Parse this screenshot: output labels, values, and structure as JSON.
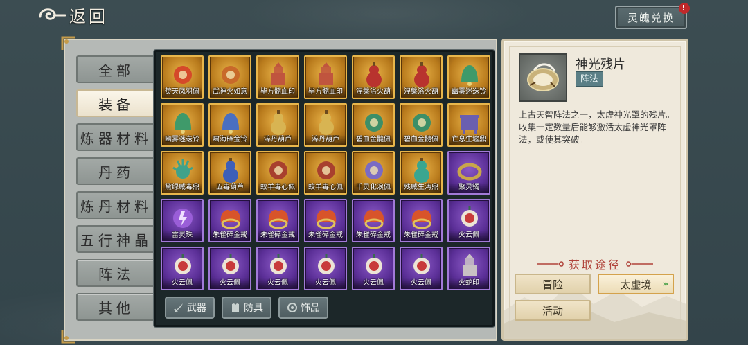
{
  "header": {
    "back_label": "返回",
    "exchange_label": "灵魄兑换",
    "exchange_badge": "!"
  },
  "categories": [
    {
      "label": "全部",
      "active": false
    },
    {
      "label": "装备",
      "active": true
    },
    {
      "label": "炼器材料",
      "active": false
    },
    {
      "label": "丹药",
      "active": false
    },
    {
      "label": "炼丹材料",
      "active": false
    },
    {
      "label": "五行神晶",
      "active": false
    },
    {
      "label": "阵法",
      "active": false
    },
    {
      "label": "其他",
      "active": false
    }
  ],
  "items": [
    {
      "name": "焚天凤羽佩",
      "rarity": "gold",
      "icon": "phoenix-feather-icon",
      "color": "#d5492a"
    },
    {
      "name": "武神火如意",
      "rarity": "gold",
      "icon": "ruyi-scepter-icon",
      "color": "#c8692a"
    },
    {
      "name": "毕方髓血印",
      "rarity": "gold",
      "icon": "seal-icon",
      "color": "#c0553e"
    },
    {
      "name": "毕方髓血印",
      "rarity": "gold",
      "icon": "seal-icon",
      "color": "#c0553e"
    },
    {
      "name": "涅槃浴火葫",
      "rarity": "gold",
      "icon": "gourd-icon",
      "color": "#b8332e"
    },
    {
      "name": "涅槃浴火葫",
      "rarity": "gold",
      "icon": "gourd-icon",
      "color": "#b8332e"
    },
    {
      "name": "幽雾迷迭铃",
      "rarity": "gold",
      "icon": "bell-icon",
      "color": "#3f9a6a"
    },
    {
      "name": "幽雾迷迭铃",
      "rarity": "gold",
      "icon": "bell-icon",
      "color": "#3f9a6a"
    },
    {
      "name": "啸海碎金铃",
      "rarity": "gold",
      "icon": "bell-icon",
      "color": "#4a6fc0"
    },
    {
      "name": "淬丹葫芦",
      "rarity": "gold",
      "icon": "gourd-icon",
      "color": "#d8b452"
    },
    {
      "name": "淬丹葫芦",
      "rarity": "gold",
      "icon": "gourd-icon",
      "color": "#d8b452"
    },
    {
      "name": "碧血金髓佩",
      "rarity": "gold",
      "icon": "jade-pendant-icon",
      "color": "#3c8f68"
    },
    {
      "name": "碧血金髓佩",
      "rarity": "gold",
      "icon": "jade-pendant-icon",
      "color": "#3c8f68"
    },
    {
      "name": "亡息生墟鼎",
      "rarity": "gold",
      "icon": "cauldron-icon",
      "color": "#6a5fb0"
    },
    {
      "name": "黛绿威毒鼎",
      "rarity": "gold",
      "icon": "spiky-orb-icon",
      "color": "#3fa28a"
    },
    {
      "name": "五毒葫芦",
      "rarity": "gold",
      "icon": "gourd-icon",
      "color": "#3d5fb8"
    },
    {
      "name": "蛟羊毒心佩",
      "rarity": "gold",
      "icon": "round-pendant-icon",
      "color": "#a8402e"
    },
    {
      "name": "蛟羊毒心佩",
      "rarity": "gold",
      "icon": "round-pendant-icon",
      "color": "#a8402e"
    },
    {
      "name": "千灵化浪佩",
      "rarity": "gold",
      "icon": "orb-pendant-icon",
      "color": "#7a6bc4"
    },
    {
      "name": "残威生涛鼎",
      "rarity": "gold",
      "icon": "gourd-icon",
      "color": "#3aa690"
    },
    {
      "name": "聚灵镯",
      "rarity": "purple",
      "icon": "bracelet-icon",
      "color": "#c9a64a"
    },
    {
      "name": "雷灵珠",
      "rarity": "purple",
      "icon": "thunder-orb-icon",
      "color": "#9a5ed8"
    },
    {
      "name": "朱雀碎金戒",
      "rarity": "purple",
      "icon": "phoenix-ring-icon",
      "color": "#d8542a"
    },
    {
      "name": "朱雀碎金戒",
      "rarity": "purple",
      "icon": "phoenix-ring-icon",
      "color": "#d8542a"
    },
    {
      "name": "朱雀碎金戒",
      "rarity": "purple",
      "icon": "phoenix-ring-icon",
      "color": "#d8542a"
    },
    {
      "name": "朱雀碎金戒",
      "rarity": "purple",
      "icon": "phoenix-ring-icon",
      "color": "#d8542a"
    },
    {
      "name": "朱雀碎金戒",
      "rarity": "purple",
      "icon": "phoenix-ring-icon",
      "color": "#d8542a"
    },
    {
      "name": "火云佩",
      "rarity": "purple",
      "icon": "knot-pendant-icon",
      "color": "#c83a3a"
    },
    {
      "name": "火云佩",
      "rarity": "purple",
      "icon": "knot-pendant-icon",
      "color": "#c83a3a"
    },
    {
      "name": "火云佩",
      "rarity": "purple",
      "icon": "knot-pendant-icon",
      "color": "#c83a3a"
    },
    {
      "name": "火云佩",
      "rarity": "purple",
      "icon": "knot-pendant-icon",
      "color": "#c83a3a"
    },
    {
      "name": "火云佩",
      "rarity": "purple",
      "icon": "knot-pendant-icon",
      "color": "#c83a3a"
    },
    {
      "name": "火云佩",
      "rarity": "purple",
      "icon": "knot-pendant-icon",
      "color": "#c83a3a"
    },
    {
      "name": "火云佩",
      "rarity": "purple",
      "icon": "knot-pendant-icon",
      "color": "#c83a3a"
    },
    {
      "name": "火蛇印",
      "rarity": "purple",
      "icon": "seal-icon",
      "color": "#c9c1c4"
    }
  ],
  "filters": [
    {
      "label": "武器",
      "icon": "sword-icon"
    },
    {
      "label": "防具",
      "icon": "armor-icon"
    },
    {
      "label": "饰品",
      "icon": "ornament-icon"
    }
  ],
  "detail": {
    "name": "神光残片",
    "tag": "阵法",
    "icon": "shard-icon",
    "description": "上古天智阵法之一，太虚神光罩的残片。收集一定数量后能够激活太虚神光罩阵法，或使其突破。",
    "source_title": "获取途径",
    "sources": [
      {
        "label": "冒险",
        "highlight": false
      },
      {
        "label": "太虚境",
        "highlight": true,
        "arrow": "»"
      },
      {
        "label": "活动",
        "highlight": false
      }
    ]
  },
  "colors": {
    "gold_frame": "#e8b64b",
    "purple_frame": "#a27ad8",
    "source_title": "#b0433a",
    "tag_bg": "#5b7f86"
  }
}
